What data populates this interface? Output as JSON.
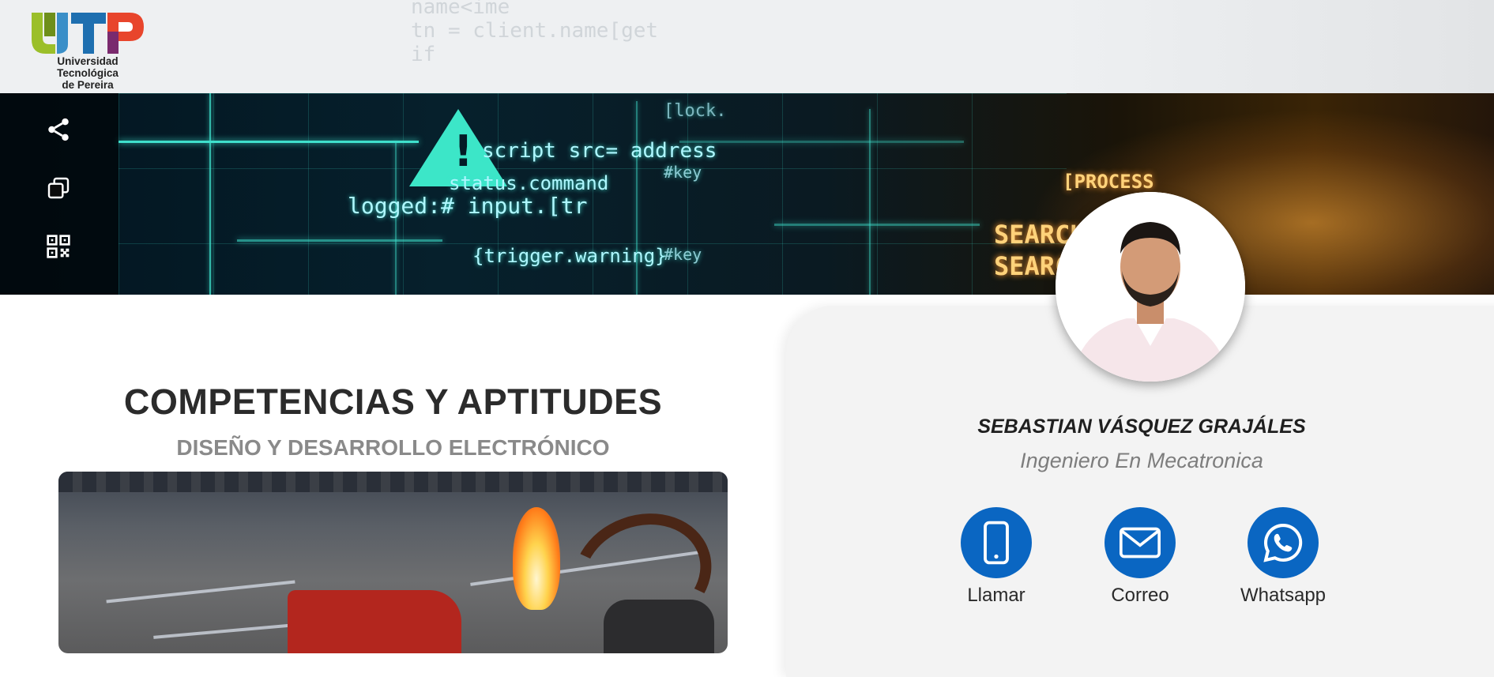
{
  "header": {
    "logo_text_line1": "Universidad Tecnológica",
    "logo_text_line2": "de Pereira"
  },
  "sidebar": {
    "items": [
      {
        "icon": "share-icon"
      },
      {
        "icon": "copy-icon"
      },
      {
        "icon": "qr-code-icon"
      }
    ]
  },
  "banner": {
    "code_lines": [
      "name<ime",
      "tn = client.name[get",
      "if"
    ],
    "script_text": "script src= address",
    "status_text": "status.command",
    "logged_text": "logged:# input.[tr",
    "trigger_text": "{trigger.warning}",
    "key_text": "#key",
    "lock_text": "[lock.",
    "process_text": "[PROCESS",
    "search_text_1": "SEARCH",
    "search_text_2": "SEARCH"
  },
  "section": {
    "title": "COMPETENCIAS Y APTITUDES",
    "subtitle": "DISEÑO Y DESARROLLO ELECTRÓNICO"
  },
  "profile": {
    "name": "SEBASTIAN VÁSQUEZ GRAJÁLES",
    "role": "Ingeniero En Mecatronica",
    "contacts": [
      {
        "label": "Llamar",
        "icon": "phone-icon"
      },
      {
        "label": "Correo",
        "icon": "mail-icon"
      },
      {
        "label": "Whatsapp",
        "icon": "whatsapp-icon"
      }
    ]
  },
  "colors": {
    "accent": "#0a66c2",
    "card_bg": "#f3f3f3",
    "neon": "#3fe0cc"
  }
}
